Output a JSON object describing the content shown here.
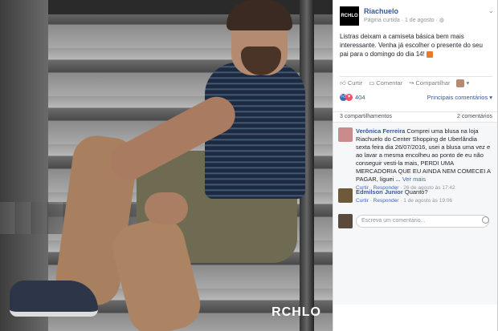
{
  "photo": {
    "watermark": "RCHLO"
  },
  "post": {
    "page_name": "Riachuelo",
    "logo_text": "RCHLO",
    "meta": "Página curtida · 1 de agosto · ",
    "text": "Listras deixam a camiseta básica bem mais interessante. Venha já escolher o presente do seu pai para o domingo do dia 14!",
    "actions": {
      "like": "Curtir",
      "comment": "Comentar",
      "share": "Compartilhar"
    },
    "reactions": {
      "count": "404",
      "sort_label": "Principais comentários"
    },
    "shares_label": "3 compartilhamentos",
    "comments_count_label": "2 comentários"
  },
  "comments": [
    {
      "name": "Verônica Ferreira",
      "text": "Comprei uma blusa na loja Riachuelo do Center Shopping de Uberlândia sexta feira dia 26/07/2016, usei a blusa uma vez e ao lavar a mesma encolheu ao ponto de eu não conseguir vesti-la mais, PERDI UMA MERCADORIA QUE EU AINDA NEM COMECEI A PAGAR, liguei ...",
      "more": "Ver mais",
      "like": "Curtir",
      "reply": "Responder",
      "time": "26 de agosto às 17:42"
    },
    {
      "name": "Edmilson Junior",
      "text": "Quanto?",
      "like": "Curtir",
      "reply": "Responder",
      "time": "1 de agosto às 19:06"
    }
  ],
  "composer": {
    "placeholder": "Escreva um comentário..."
  }
}
